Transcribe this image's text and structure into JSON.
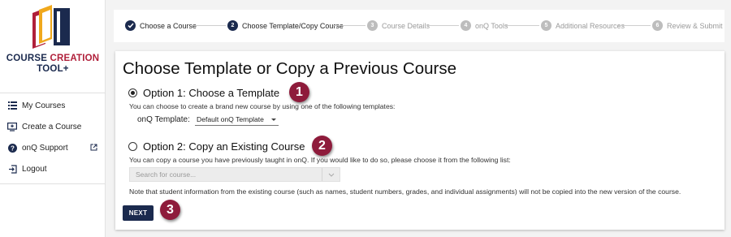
{
  "sidebar": {
    "brand_line1_a": "COURSE",
    "brand_line1_b": "CREATION",
    "brand_line2": "TOOL+",
    "items": [
      {
        "label": "My Courses",
        "icon": "list-icon"
      },
      {
        "label": "Create a Course",
        "icon": "add-screen-icon"
      },
      {
        "label": "onQ Support",
        "icon": "help-icon"
      },
      {
        "label": "Logout",
        "icon": "logout-icon"
      }
    ]
  },
  "stepper": {
    "steps": [
      {
        "num": "",
        "label": "Choose a Course",
        "state": "done"
      },
      {
        "num": "2",
        "label": "Choose Template/Copy Course",
        "state": "active"
      },
      {
        "num": "3",
        "label": "Course Details",
        "state": "pending"
      },
      {
        "num": "4",
        "label": "onQ Tools",
        "state": "pending"
      },
      {
        "num": "5",
        "label": "Additional Resources",
        "state": "pending"
      },
      {
        "num": "6",
        "label": "Review & Submit",
        "state": "pending"
      }
    ]
  },
  "main": {
    "title": "Choose Template or Copy a Previous Course",
    "option1": {
      "label": "Option 1: Choose a Template",
      "selected": true,
      "description": "You can choose to create a brand new course by using one of the following templates:",
      "template_label": "onQ Template:",
      "template_value": "Default onQ Template"
    },
    "option2": {
      "label": "Option 2: Copy an Existing Course",
      "selected": false,
      "description": "You can copy a course you have previously taught in onQ. If you would like to do so, please choose it from the following list:",
      "search_placeholder": "Search for course...",
      "note": "Note that student information from the existing course (such as names, student numbers, grades, and individual assignments) will not be copied into the new version of the course."
    },
    "next_label": "NEXT",
    "badges": [
      "1",
      "2",
      "3"
    ]
  },
  "colors": {
    "navy": "#1b2a4e",
    "brand_red": "#b01f3a",
    "badge": "#8e1b3b",
    "pending_gray": "#bdbdbd"
  }
}
